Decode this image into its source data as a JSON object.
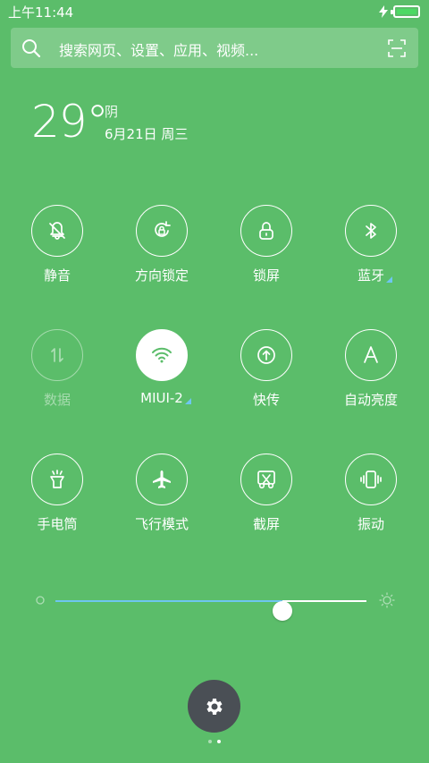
{
  "status_bar": {
    "time": "上午11:44",
    "battery_level": 1.0,
    "charging": true
  },
  "search": {
    "placeholder": "搜索网页、设置、应用、视频..."
  },
  "weather": {
    "temperature": "29°",
    "condition": "阴",
    "date": "6月21日 周三"
  },
  "tiles": [
    {
      "id": "mute",
      "label": "静音",
      "icon": "bell-off-icon",
      "state": "off"
    },
    {
      "id": "rotation-lock",
      "label": "方向锁定",
      "icon": "rotation-lock-icon",
      "state": "off"
    },
    {
      "id": "lock-screen",
      "label": "锁屏",
      "icon": "lock-icon",
      "state": "off"
    },
    {
      "id": "bluetooth",
      "label": "蓝牙",
      "icon": "bluetooth-icon",
      "state": "off",
      "has_more": true
    },
    {
      "id": "data",
      "label": "数据",
      "icon": "data-arrows-icon",
      "state": "disabled"
    },
    {
      "id": "wifi",
      "label": "MIUI-2",
      "icon": "wifi-icon",
      "state": "on",
      "has_more": true
    },
    {
      "id": "quick-transfer",
      "label": "快传",
      "icon": "upload-circle-icon",
      "state": "off"
    },
    {
      "id": "auto-brightness",
      "label": "自动亮度",
      "icon": "letter-a-icon",
      "state": "off"
    },
    {
      "id": "flashlight",
      "label": "手电筒",
      "icon": "flashlight-icon",
      "state": "off"
    },
    {
      "id": "airplane",
      "label": "飞行模式",
      "icon": "airplane-icon",
      "state": "off"
    },
    {
      "id": "screenshot",
      "label": "截屏",
      "icon": "scissors-icon",
      "state": "off"
    },
    {
      "id": "vibrate",
      "label": "振动",
      "icon": "vibrate-icon",
      "state": "off"
    }
  ],
  "brightness": {
    "level": 0.73
  },
  "colors": {
    "background": "#5bbd6a",
    "accent": "#6ec6f0",
    "fab": "#4a4f55"
  },
  "pager": {
    "count": 2,
    "active": 1
  }
}
